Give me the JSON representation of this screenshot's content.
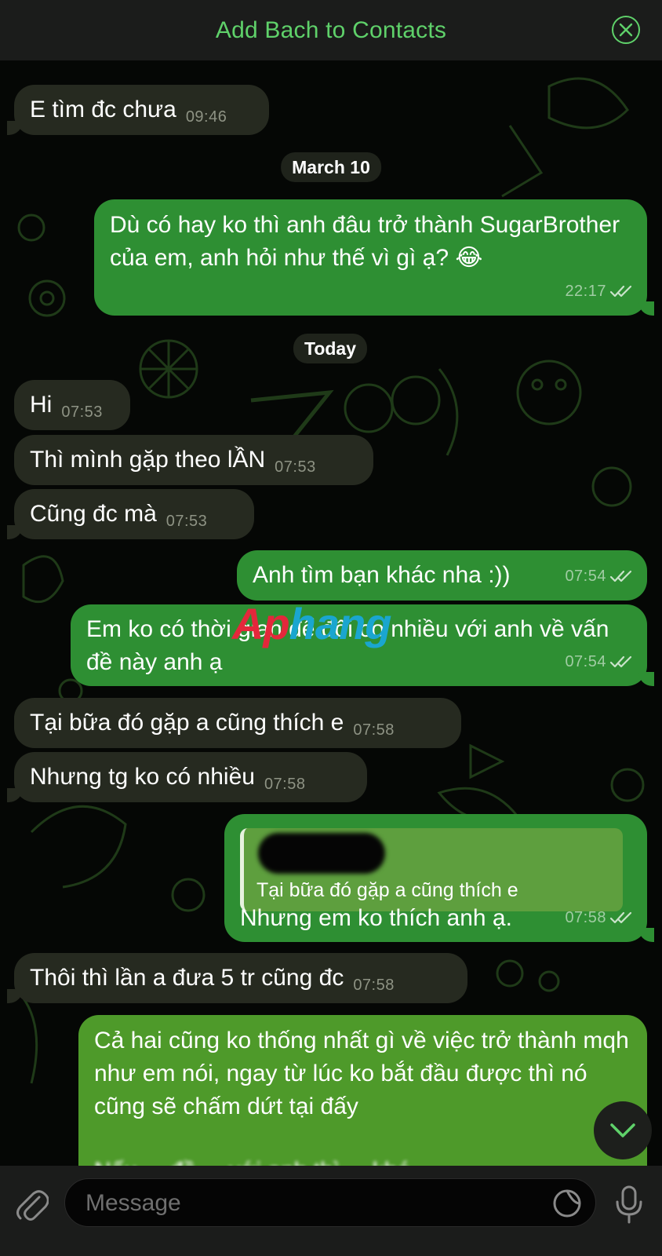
{
  "header": {
    "title": "Add Bach to Contacts",
    "close_icon": "close-circle-icon"
  },
  "chat": {
    "date_separators": [
      "March 10",
      "Today"
    ],
    "messages": [
      {
        "dir": "in",
        "text": "E tìm đc chưa",
        "time": "09:46"
      },
      {
        "dir": "out",
        "text": "Dù có hay ko thì anh đâu trở thành SugarBrother của em, anh hỏi như thế vì gì ạ? 😂",
        "time": "22:17",
        "status": "read"
      },
      {
        "dir": "in",
        "text": "Hi",
        "time": "07:53"
      },
      {
        "dir": "in",
        "text": "Thì mình gặp theo lẦN",
        "time": "07:53"
      },
      {
        "dir": "in",
        "text": "Cũng đc mà",
        "time": "07:53"
      },
      {
        "dir": "out",
        "text": "Anh tìm bạn khác nha :))",
        "time": "07:54",
        "status": "read"
      },
      {
        "dir": "out",
        "text": "Em ko có thời gian để đôi co nhiều với anh về vấn đề này anh ạ",
        "time": "07:54",
        "status": "read"
      },
      {
        "dir": "in",
        "text": "Tại bữa đó gặp a cũng thích e",
        "time": "07:58"
      },
      {
        "dir": "in",
        "text": "Nhưng tg ko có nhiều",
        "time": "07:58"
      },
      {
        "dir": "out",
        "reply_to": "Tại bữa đó gặp a cũng thích e",
        "text": "Nhưng em ko thích anh ạ.",
        "time": "07:58",
        "status": "read"
      },
      {
        "dir": "in",
        "text": "Thôi thì lần a đưa 5 tr cũng đc",
        "time": "07:58"
      },
      {
        "dir": "out",
        "text": "Cả hai cũng ko thống nhất gì về việc trở thành mqh như em nói, ngay từ lúc ko bắt đầu được thì nó cũng sẽ chấm dứt tại đấy",
        "partial_text": "Nếu ... đề ... với anh thì ... khó ... ",
        "time": "",
        "status": ""
      }
    ]
  },
  "composer": {
    "placeholder": "Message",
    "attach_icon": "paperclip-icon",
    "sticker_icon": "sticker-icon",
    "mic_icon": "microphone-icon"
  },
  "scroll_button_icon": "chevron-down-icon",
  "watermark": {
    "part1": "Ap",
    "part2": "hang"
  },
  "colors": {
    "accent": "#5fd16a",
    "incoming_bubble": "#262a20",
    "outgoing_bubble": "#2e8f33",
    "background": "#050705"
  }
}
